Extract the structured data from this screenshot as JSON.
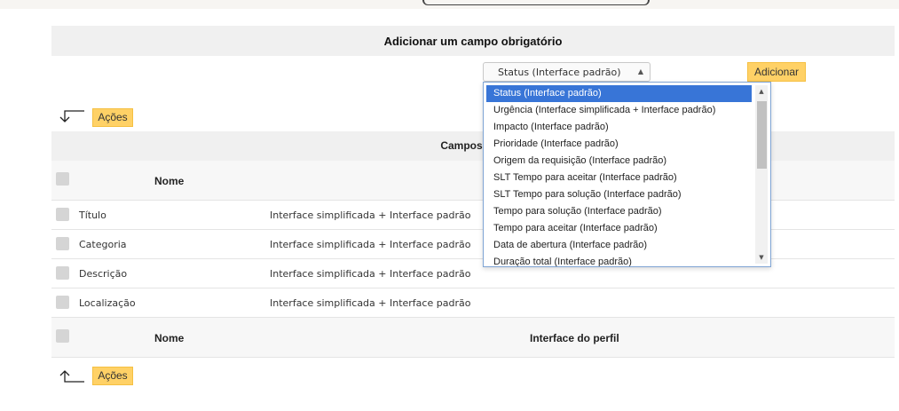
{
  "add_panel": {
    "title": "Adicionar um campo obrigatório",
    "select_value": "Status (Interface padrão)",
    "add_button": "Adicionar",
    "options": [
      "Status (Interface padrão)",
      "Urgência (Interface simplificada + Interface padrão)",
      "Impacto (Interface padrão)",
      "Prioridade (Interface padrão)",
      "Origem da requisição (Interface padrão)",
      "SLT Tempo para aceitar (Interface padrão)",
      "SLT Tempo para solução (Interface padrão)",
      "Tempo para solução (Interface padrão)",
      "Tempo para aceitar (Interface padrão)",
      "Data de abertura (Interface padrão)",
      "Duração total (Interface padrão)"
    ]
  },
  "actions": {
    "top_label": "Ações",
    "bottom_label": "Ações"
  },
  "table": {
    "title": "Campos obri",
    "header": {
      "name": "Nome",
      "interface": ""
    },
    "footer": {
      "name": "Nome",
      "interface": "Interface do perfil"
    },
    "rows": [
      {
        "name": "Título",
        "interface": "Interface simplificada + Interface padrão"
      },
      {
        "name": "Categoria",
        "interface": "Interface simplificada + Interface padrão"
      },
      {
        "name": "Descrição",
        "interface": "Interface simplificada + Interface padrão"
      },
      {
        "name": "Localização",
        "interface": "Interface simplificada + Interface padrão"
      }
    ]
  },
  "colors": {
    "accent_button": "#ffd166",
    "selected_option": "#3875d7",
    "header_bg": "#f0f0f0"
  }
}
